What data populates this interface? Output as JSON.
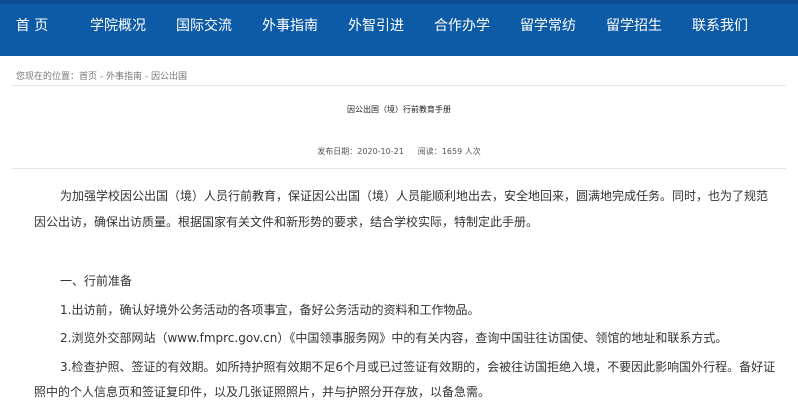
{
  "nav": {
    "items": [
      {
        "label": "首 页"
      },
      {
        "label": "学院概况"
      },
      {
        "label": "国际交流"
      },
      {
        "label": "外事指南"
      },
      {
        "label": "外智引进"
      },
      {
        "label": "合作办学"
      },
      {
        "label": "留学常纺"
      },
      {
        "label": "留学招生"
      },
      {
        "label": "联系我们"
      }
    ],
    "bg_color": "#0d5aa7"
  },
  "breadcrumb": {
    "prefix": "您现在的位置：",
    "items": [
      "首页",
      "外事指南",
      "因公出国"
    ],
    "separator": " - "
  },
  "article": {
    "title": "因公出国（境）行前教育手册",
    "publish_label": "发布日期：",
    "publish_date": "2020-10-21",
    "views_label": "阅读：",
    "views": "1659",
    "views_unit": " 人次",
    "paragraphs": [
      "为加强学校因公出国（境）人员行前教育，保证因公出国（境）人员能顺利地出去，安全地回来，圆满地完成任务。同时，也为了规范",
      "因公出访，确保出访质量。根据国家有关文件和新形势的要求，结合学校实际，特制定此手册。",
      "一、行前准备",
      "1.出访前，确认好境外公务活动的各项事宜，备好公务活动的资料和工作物品。",
      "2.浏览外交部网站（www.fmprc.gov.cn）《中国领事服务网》中的有关内容，查询中国驻往访国使、领馆的地址和联系方式。",
      "3.检查护照、签证的有效期。如所持护照有效期不足6个月或已过签证有效期的，会被往访国拒绝入境，不要因此影响国外行程。备好证",
      "照中的个人信息页和签证复印件，以及几张证照照片，并与护照分开存放，以备急需。"
    ]
  }
}
